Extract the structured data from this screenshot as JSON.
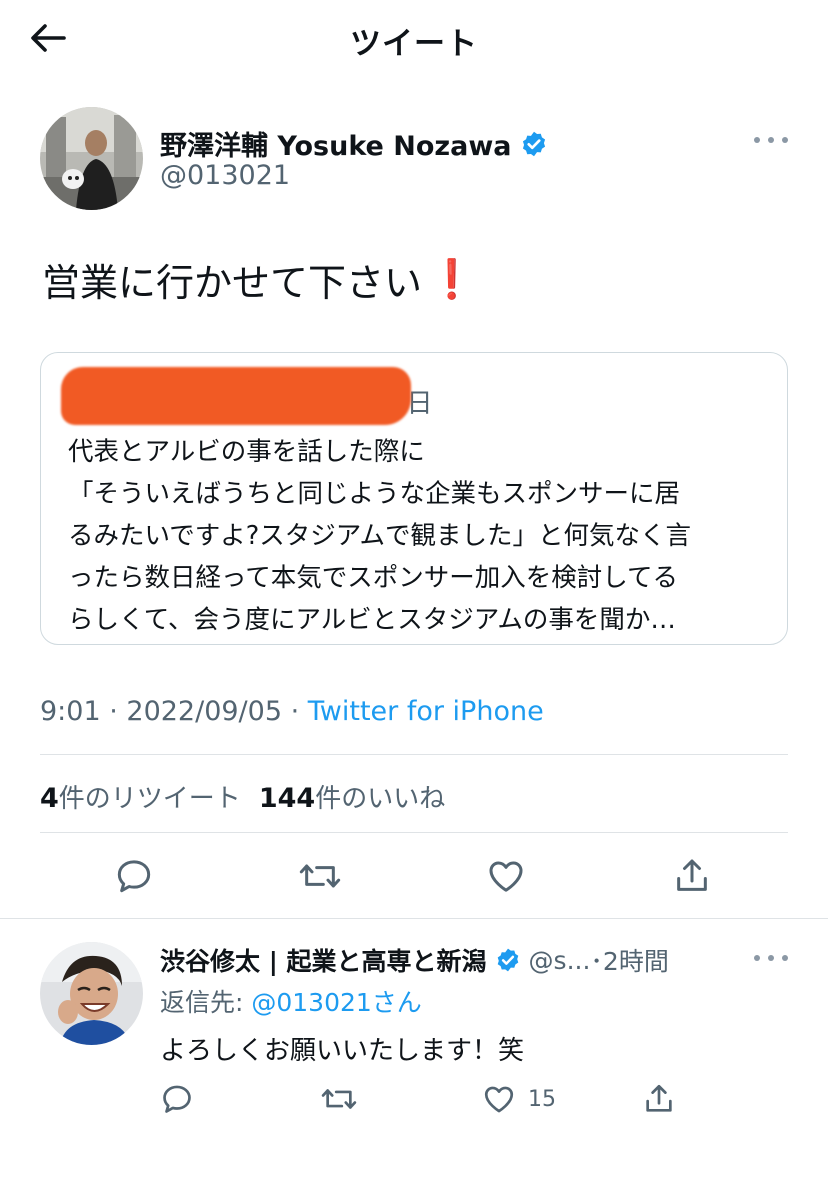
{
  "header": {
    "title": "ツイート"
  },
  "tweet": {
    "author": {
      "display_name": "野澤洋輔 Yosuke Nozawa",
      "handle": "@013021"
    },
    "text": "営業に行かせて下さい",
    "emoji": "❗",
    "quote": {
      "meta": "･2日",
      "lines": [
        "代表とアルビの事を話した際に",
        "「そういえばうちと同じような企業もスポンサーに居",
        "るみたいですよ?スタジアムで観ました」と何気なく言",
        "ったら数日経って本気でスポンサー加入を検討してる",
        "らしくて、会う度にアルビとスタジアムの事を聞か…"
      ]
    },
    "time": "9:01",
    "date": "2022/09/05",
    "separator": " · ",
    "source": "Twitter for iPhone",
    "retweet_count": "4",
    "retweet_label": "件のリツイート",
    "like_count": "144",
    "like_label": "件のいいね"
  },
  "reply": {
    "author": {
      "display_name": "渋谷修太 | 起業と高専と新潟",
      "handle": "@s...",
      "time": "･2時間"
    },
    "reply_to_prefix": "返信先: ",
    "reply_to_handle": "@013021さん",
    "text": "よろしくお願いいたします！笑",
    "like_count": "15"
  },
  "colors": {
    "text": "#0f1419",
    "secondary": "#536471",
    "link": "#1d9bf0",
    "verified": "#1d9bf0",
    "divider": "#dfe3e6",
    "redaction": "#f15a24"
  },
  "icons": [
    "back-arrow-icon",
    "verified-badge-icon",
    "more-icon",
    "reply-icon",
    "retweet-icon",
    "like-icon",
    "share-icon"
  ]
}
